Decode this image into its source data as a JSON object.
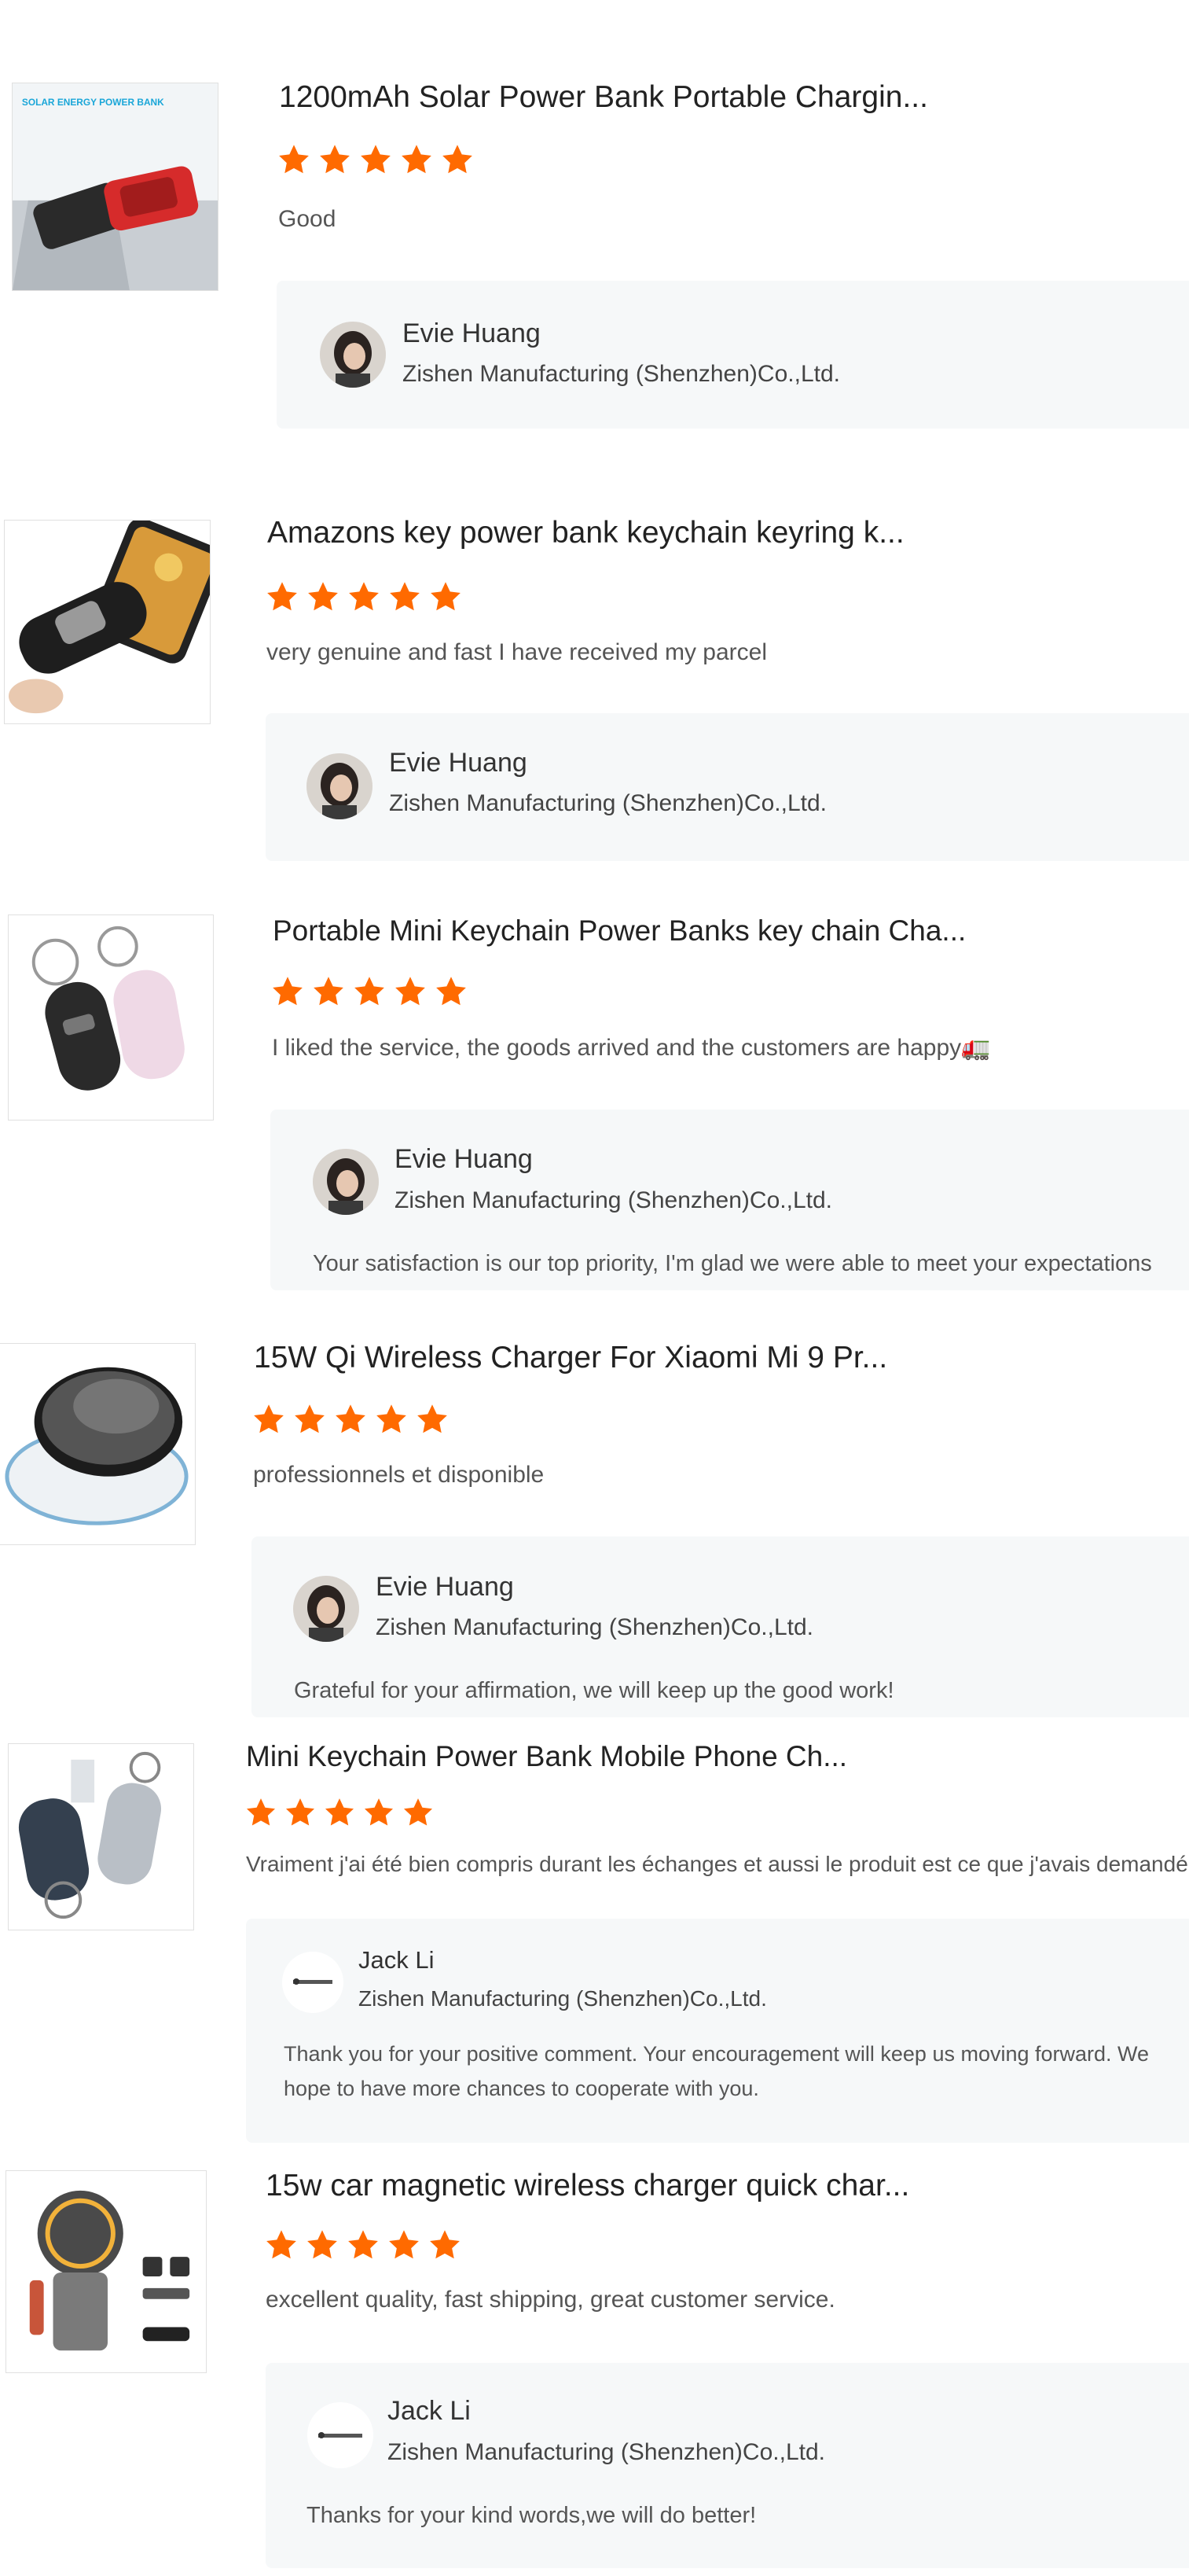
{
  "colors": {
    "star": "#ff6a00",
    "reply_bg": "#f6f8f9"
  },
  "reviews": [
    {
      "title": "1200mAh Solar Power Bank Portable Chargin...",
      "rating": 5,
      "text": "Good",
      "thumb_icon": "solar-power-bank-image",
      "thumb_caption": "SOLAR ENERGY POWER BANK",
      "reply": {
        "name": "Evie Huang",
        "company": "Zishen Manufacturing (Shenzhen)Co.,Ltd.",
        "message": ""
      }
    },
    {
      "title": "Amazons key power bank keychain keyring k...",
      "rating": 5,
      "text": "very genuine and fast I have received my parcel",
      "thumb_icon": "keychain-power-bank-image",
      "reply": {
        "name": "Evie Huang",
        "company": "Zishen Manufacturing (Shenzhen)Co.,Ltd.",
        "message": ""
      }
    },
    {
      "title": "Portable Mini Keychain Power Banks key chain Cha...",
      "rating": 5,
      "text": "I liked the service, the goods arrived and the customers are happy🚛",
      "thumb_icon": "mini-keychain-power-banks-image",
      "reply": {
        "name": "Evie Huang",
        "company": "Zishen Manufacturing (Shenzhen)Co.,Ltd.",
        "message": "Your satisfaction is our top priority, I'm glad we were able to meet your expectations"
      }
    },
    {
      "title": "15W Qi Wireless Charger For Xiaomi Mi 9 Pr...",
      "rating": 5,
      "text": "professionnels et disponible",
      "thumb_icon": "wireless-charger-image",
      "reply": {
        "name": "Evie Huang",
        "company": "Zishen Manufacturing (Shenzhen)Co.,Ltd.",
        "message": "Grateful for your affirmation, we will keep up the good work!"
      }
    },
    {
      "title": "Mini Keychain Power Bank Mobile Phone Ch...",
      "rating": 5,
      "text": "Vraiment j'ai été bien compris durant les échanges et aussi le produit est ce que j'avais demandé",
      "thumb_icon": "mini-keychain-power-bank-image",
      "reply": {
        "name": "Jack Li",
        "company": "Zishen Manufacturing (Shenzhen)Co.,Ltd.",
        "message": "Thank you for your positive comment. Your encouragement will keep us moving forward. We hope to have more chances to cooperate with you."
      }
    },
    {
      "title": "15w car magnetic wireless charger quick char...",
      "rating": 5,
      "text": "excellent quality, fast shipping, great customer service.",
      "thumb_icon": "car-magnetic-charger-image",
      "reply": {
        "name": "Jack Li",
        "company": "Zishen Manufacturing (Shenzhen)Co.,Ltd.",
        "message": "Thanks for your kind words,we will do better!"
      }
    }
  ]
}
